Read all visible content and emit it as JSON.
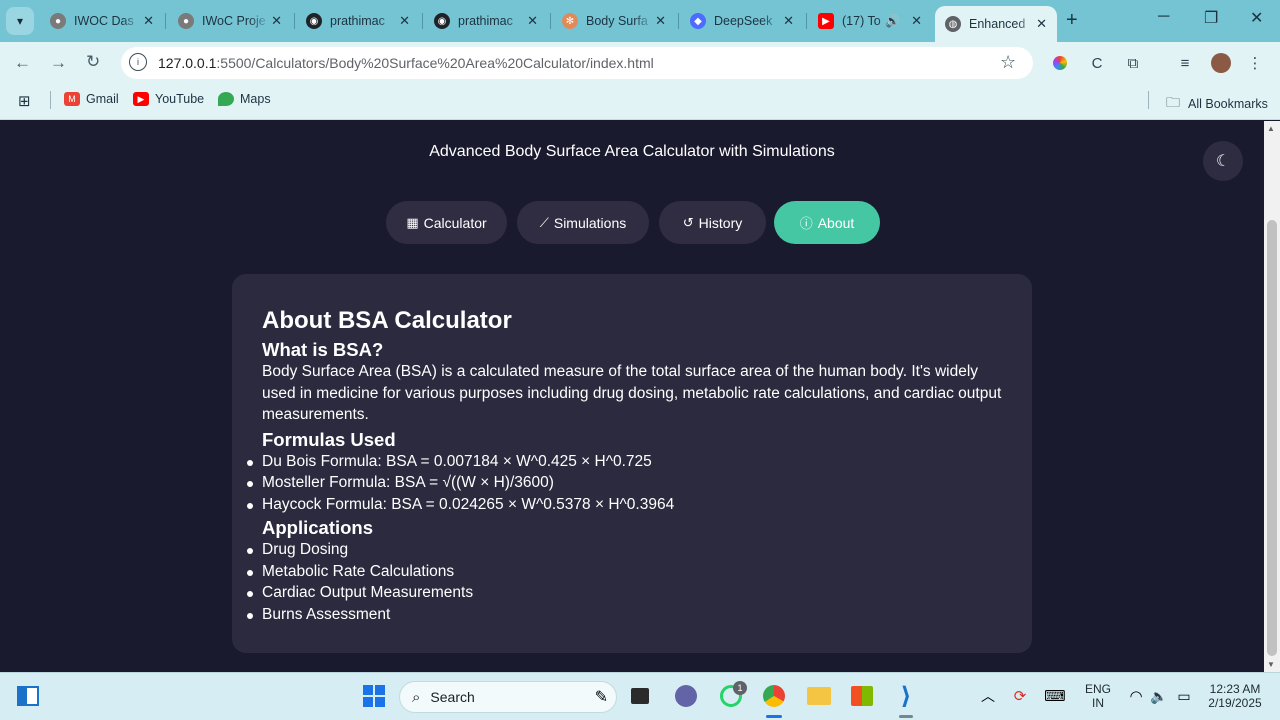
{
  "browser": {
    "tabs": [
      {
        "title": "IWOC Das",
        "favicon": "iwoc-icon",
        "color": "#7a7a7a"
      },
      {
        "title": "IWoC Proje",
        "favicon": "iwoc-icon",
        "color": "#7a7a7a"
      },
      {
        "title": "prathimac",
        "favicon": "github-icon",
        "color": "#1f2328"
      },
      {
        "title": "prathimac",
        "favicon": "github-icon",
        "color": "#1f2328"
      },
      {
        "title": "Body Surfa",
        "favicon": "bsa-icon",
        "color": "#e08a5a"
      },
      {
        "title": "DeepSeek",
        "favicon": "deepseek-icon",
        "color": "#4d6bfe"
      },
      {
        "title": "(17) To",
        "favicon": "youtube-icon",
        "color": "#ff0000"
      },
      {
        "title": "Enhanced",
        "favicon": "globe-icon",
        "color": "#5f6368"
      }
    ],
    "url_host": "127.0.0.1",
    "url_path": ":5500/Calculators/Body%20Surface%20Area%20Calculator/index.html",
    "bookmarks": [
      {
        "label": "Gmail",
        "icon": "gmail-icon",
        "color": "#ea4335"
      },
      {
        "label": "YouTube",
        "icon": "youtube-icon",
        "color": "#ff0000"
      },
      {
        "label": "Maps",
        "icon": "maps-icon",
        "color": "#34a853"
      }
    ],
    "all_bookmarks": "All Bookmarks"
  },
  "app": {
    "title": "Advanced Body Surface Area Calculator with Simulations",
    "nav": [
      {
        "label": "Calculator",
        "icon": "calculator-icon"
      },
      {
        "label": "Simulations",
        "icon": "chart-line-icon"
      },
      {
        "label": "History",
        "icon": "history-icon"
      },
      {
        "label": "About",
        "icon": "info-icon",
        "active": true
      }
    ],
    "about": {
      "heading": "About BSA Calculator",
      "what_heading": "What is BSA?",
      "what_text": "Body Surface Area (BSA) is a calculated measure of the total surface area of the human body. It's widely used in medicine for various purposes including drug dosing, metabolic rate calculations, and cardiac output measurements.",
      "formulas_heading": "Formulas Used",
      "formulas": [
        "Du Bois Formula: BSA = 0.007184 × W^0.425 × H^0.725",
        "Mosteller Formula: BSA = √((W × H)/3600)",
        "Haycock Formula: BSA = 0.024265 × W^0.5378 × H^0.3964"
      ],
      "applications_heading": "Applications",
      "applications": [
        "Drug Dosing",
        "Metabolic Rate Calculations",
        "Cardiac Output Measurements",
        "Burns Assessment"
      ]
    }
  },
  "taskbar": {
    "search_placeholder": "Search",
    "whatsapp_badge": "1",
    "lang_top": "ENG",
    "lang_bottom": "IN",
    "time": "12:23 AM",
    "date": "2/19/2025"
  }
}
